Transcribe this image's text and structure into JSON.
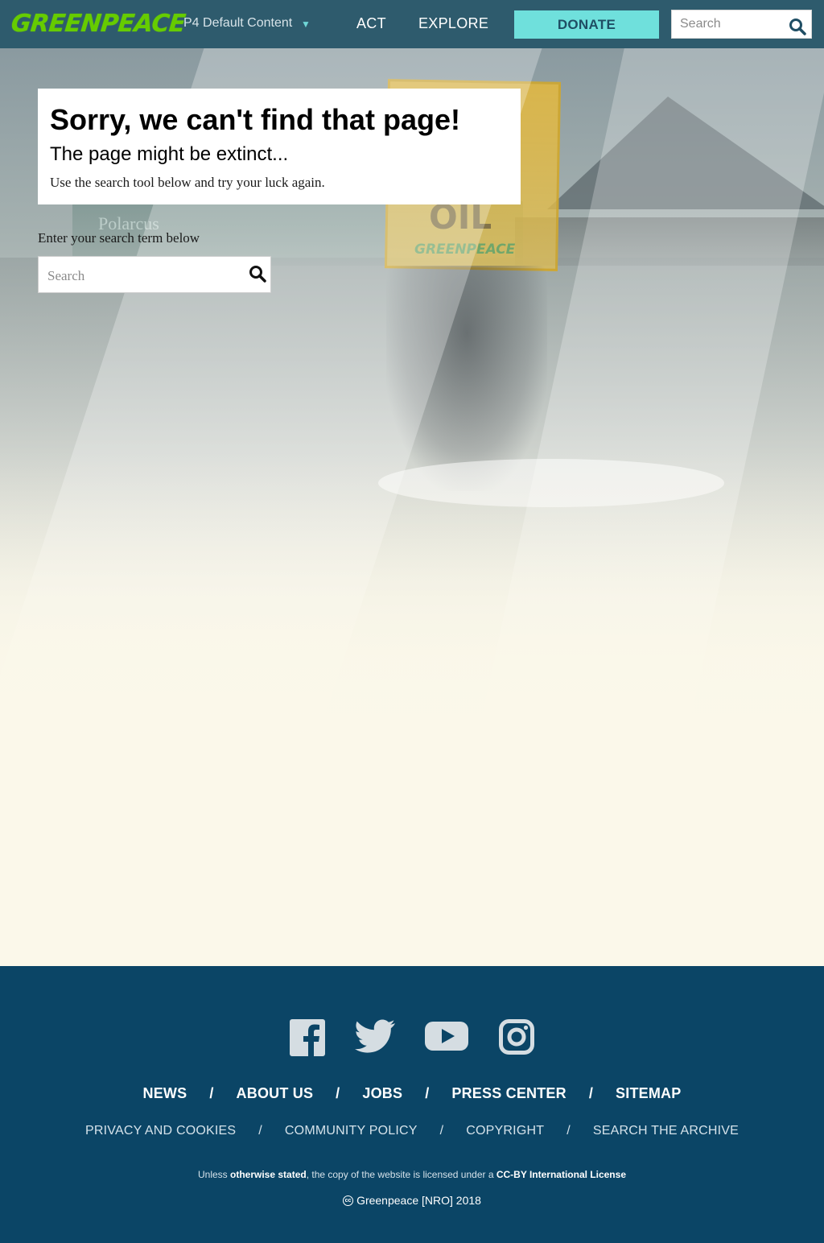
{
  "header": {
    "logo_text": "GREENPEACE",
    "nro_selector": "P4 Default Content",
    "nro_caret": "▼",
    "nav": {
      "act": "ACT",
      "explore": "EXPLORE"
    },
    "donate_label": "DONATE",
    "search_placeholder": "Search",
    "colors": {
      "background": "#2e5b6d",
      "logo": "#66cc00",
      "donate": "#6fe0dc"
    }
  },
  "hero": {
    "sign_text": "OIL",
    "sign_logo": "GREENPEACE",
    "ship_name": "Polarcus"
  },
  "error": {
    "title": "Sorry, we can't find that page!",
    "subtitle": "The page might be extinct...",
    "text": "Use the search tool below and try your luck again."
  },
  "search": {
    "label": "Enter your search term below",
    "placeholder": "Search"
  },
  "footer": {
    "social": [
      "facebook-icon",
      "twitter-icon",
      "youtube-icon",
      "instagram-icon"
    ],
    "primary_links": [
      "NEWS",
      "ABOUT US",
      "JOBS",
      "PRESS CENTER",
      "SITEMAP"
    ],
    "secondary_links": [
      "PRIVACY AND COOKIES",
      "COMMUNITY POLICY",
      "COPYRIGHT",
      "SEARCH THE ARCHIVE"
    ],
    "separator": "/",
    "license": {
      "prefix": "Unless ",
      "link1": "otherwise stated",
      "middle": ", the copy of the website is licensed under a ",
      "link2": "CC-BY International License"
    },
    "copyright": "Greenpeace [NRO] 2018",
    "cc_icon_text": "cc",
    "colors": {
      "background": "#0b4566"
    }
  }
}
